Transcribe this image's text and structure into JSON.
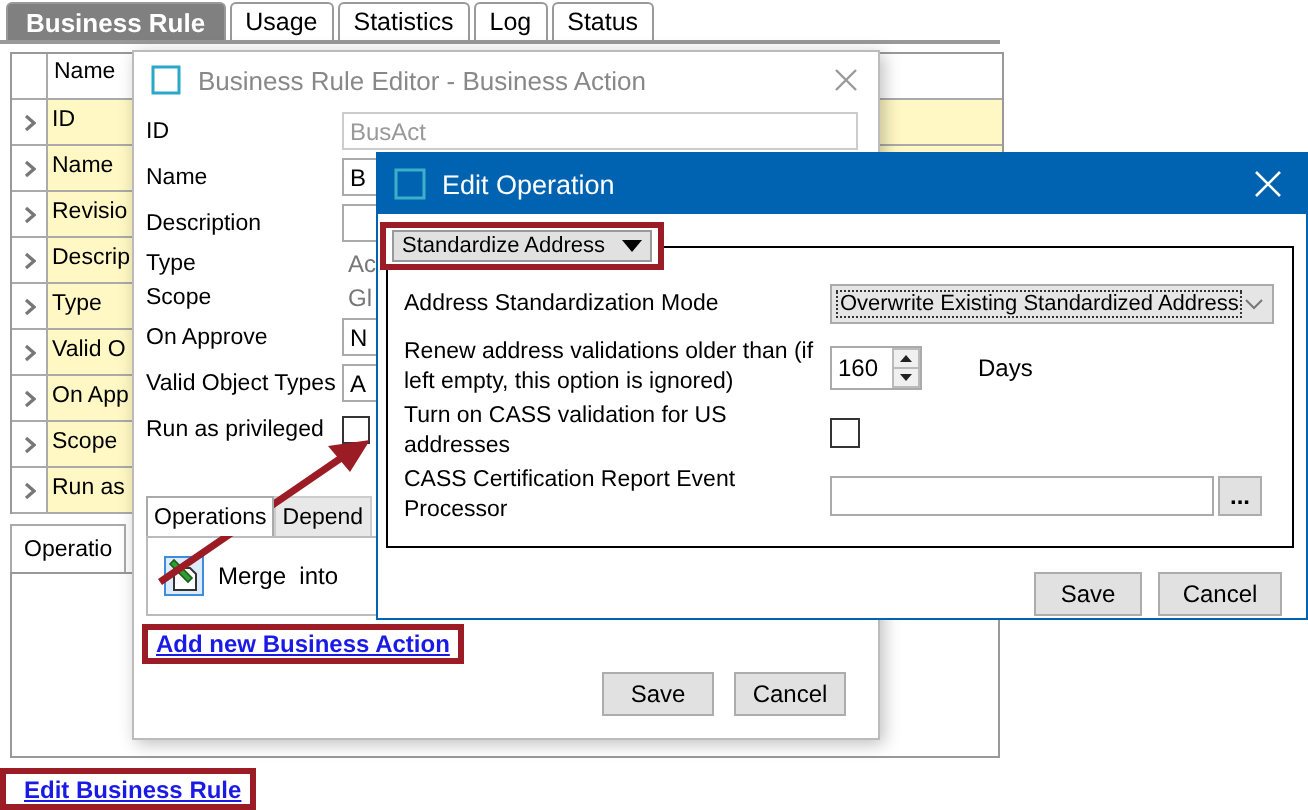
{
  "main_tabs": [
    {
      "label": "Business Rule",
      "selected": true
    },
    {
      "label": "Usage",
      "selected": false
    },
    {
      "label": "Statistics",
      "selected": false
    },
    {
      "label": "Log",
      "selected": false
    },
    {
      "label": "Status",
      "selected": false
    }
  ],
  "property_table": {
    "header": "Name",
    "rows": [
      "ID",
      "Name",
      "Revisio",
      "Descrip",
      "Type",
      "Valid O",
      "On App",
      "Scope",
      "Run as"
    ]
  },
  "lower_tabs": [
    {
      "label": "Operatio",
      "selected": true
    }
  ],
  "edit_link": "Edit Business Rule",
  "editor_dialog": {
    "title": "Business Rule Editor - Business Action",
    "fields": [
      {
        "kind": "text",
        "label": "ID",
        "value": "BusAct",
        "disabled": true
      },
      {
        "kind": "text",
        "label": "Name",
        "value": "B",
        "disabled": false
      },
      {
        "kind": "text",
        "label": "Description",
        "disabled": false
      },
      {
        "kind": "static",
        "label": "Type",
        "value": "Ac"
      },
      {
        "kind": "static",
        "label": "Scope",
        "value": "Gl"
      },
      {
        "kind": "text",
        "label": "On Approve",
        "value": "N",
        "disabled": false
      },
      {
        "kind": "text",
        "label": "Valid Object Types",
        "value": "A",
        "disabled": false
      },
      {
        "kind": "checkbox",
        "label": "Run as privileged",
        "checked": false
      }
    ],
    "tabs": [
      {
        "label": "Operations",
        "selected": true
      },
      {
        "label": "Depend",
        "selected": false
      }
    ],
    "operations": [
      {
        "label": "Merge  into"
      }
    ],
    "add_link": "Add new Business Action",
    "buttons": [
      "Save",
      "Cancel"
    ]
  },
  "operation_dialog": {
    "title": "Edit Operation",
    "operation_type": "Standardize Address",
    "rows": [
      {
        "kind": "select",
        "label": "Address Standardization Mode",
        "value": "Overwrite Existing Standardized Address"
      },
      {
        "kind": "spinner",
        "label": "Renew address validations older than (if left empty, this option is ignored)",
        "value": "160",
        "unit": "Days"
      },
      {
        "kind": "checkbox",
        "label": "Turn on CASS validation for US addresses",
        "checked": false
      },
      {
        "kind": "browse",
        "label": "CASS Certification Report Event Processor",
        "button": "..."
      }
    ],
    "buttons": [
      "Save",
      "Cancel"
    ]
  }
}
